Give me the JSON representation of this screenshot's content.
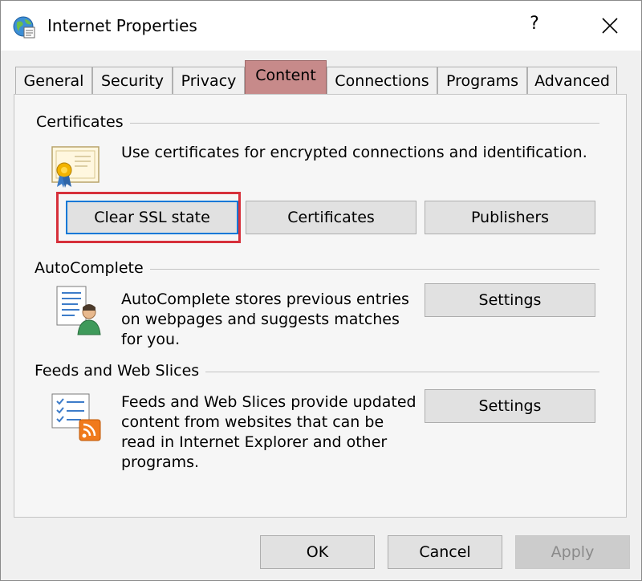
{
  "window": {
    "title": "Internet Properties",
    "help_label": "?"
  },
  "tabs": [
    {
      "label": "General"
    },
    {
      "label": "Security"
    },
    {
      "label": "Privacy"
    },
    {
      "label": "Content",
      "active": true
    },
    {
      "label": "Connections"
    },
    {
      "label": "Programs"
    },
    {
      "label": "Advanced"
    }
  ],
  "certificates": {
    "group_label": "Certificates",
    "description": "Use certificates for encrypted connections and identification.",
    "clear_ssl_label": "Clear SSL state",
    "certificates_label": "Certificates",
    "publishers_label": "Publishers"
  },
  "autocomplete": {
    "group_label": "AutoComplete",
    "description_lines": [
      "AutoComplete stores previous entries",
      "on webpages and suggests matches",
      "for you."
    ],
    "settings_label": "Settings"
  },
  "feeds": {
    "group_label": "Feeds and Web Slices",
    "description_lines": [
      "Feeds and Web Slices provide updated",
      "content from websites that can be",
      "read in Internet Explorer and other",
      "programs."
    ],
    "settings_label": "Settings"
  },
  "footer": {
    "ok_label": "OK",
    "cancel_label": "Cancel",
    "apply_label": "Apply"
  },
  "colors": {
    "active_tab": "#c78a8a",
    "focus_border": "#0078d7",
    "highlight_box": "#d6303b"
  },
  "icons": {
    "app": "internet-globe-icon",
    "certificate": "certificate-icon",
    "autocomplete": "autocomplete-icon",
    "feeds": "feeds-icon"
  }
}
